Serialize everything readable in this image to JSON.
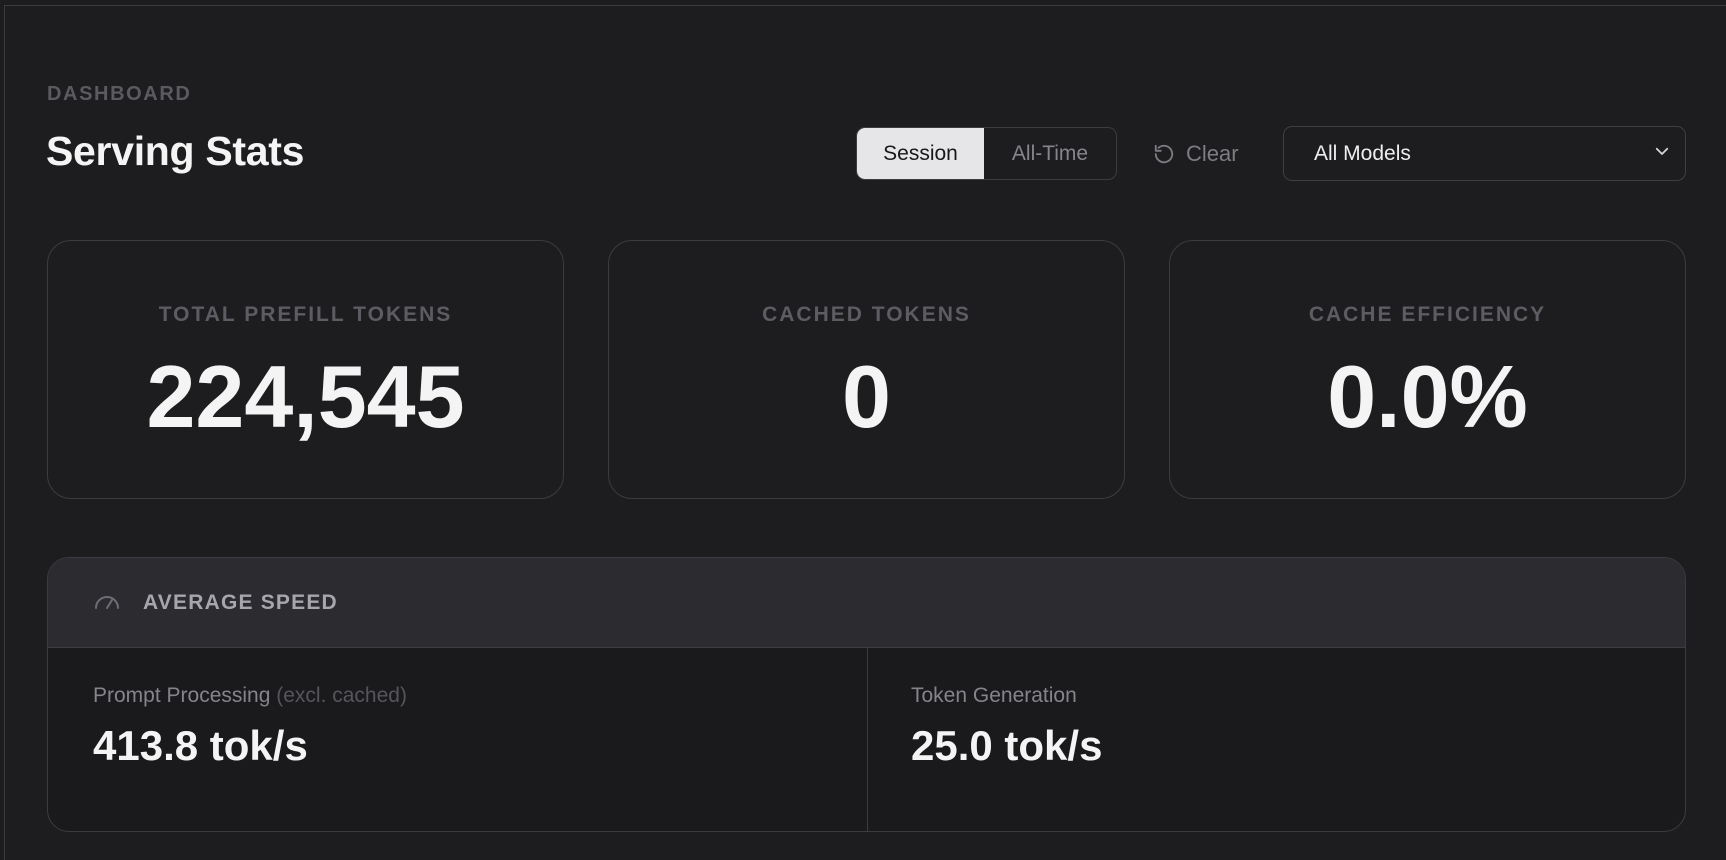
{
  "header": {
    "eyebrow": "DASHBOARD",
    "title": "Serving Stats"
  },
  "controls": {
    "scope_tabs": [
      {
        "label": "Session",
        "active": true
      },
      {
        "label": "All-Time",
        "active": false
      }
    ],
    "clear_label": "Clear",
    "clear_icon": "rotate-ccw-icon",
    "model_select": {
      "value": "All Models",
      "icon": "chevron-down-icon"
    }
  },
  "cards": [
    {
      "label": "TOTAL PREFILL TOKENS",
      "value": "224,545"
    },
    {
      "label": "CACHED TOKENS",
      "value": "0"
    },
    {
      "label": "CACHE EFFICIENCY",
      "value": "0.0%"
    }
  ],
  "average_speed": {
    "icon": "gauge-icon",
    "title": "AVERAGE SPEED",
    "metrics": [
      {
        "label": "Prompt Processing",
        "note": "(excl. cached)",
        "value": "413.8 tok/s"
      },
      {
        "label": "Token Generation",
        "note": "",
        "value": "25.0 tok/s"
      }
    ]
  },
  "colors": {
    "background": "#1d1d20",
    "panel_header": "#2b2b30",
    "border": "#3b3b41",
    "text_primary": "#f4f4f5",
    "text_muted": "#5c5c62",
    "active_tab_bg": "#e6e6e8"
  }
}
